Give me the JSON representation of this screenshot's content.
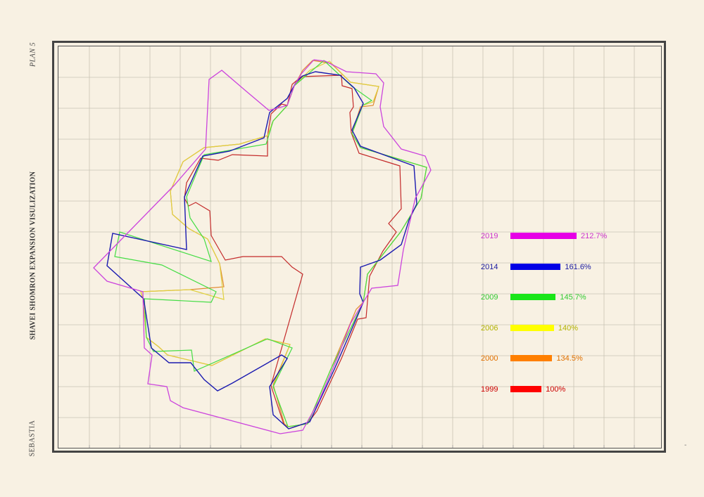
{
  "labels": {
    "plan": "PLAN 5",
    "title": "SHAVEI SHOMRON EXPANSION VISULIZATION",
    "place": "SEBASTIA"
  },
  "legend": [
    {
      "year": "2019",
      "percent_label": "212.7%",
      "percent": 212.7,
      "color": "#e600e6",
      "text_color": "#cc33cc"
    },
    {
      "year": "2014",
      "percent_label": "161.6%",
      "percent": 161.6,
      "color": "#0000e6",
      "text_color": "#1a1aa0"
    },
    {
      "year": "2009",
      "percent_label": "145.7%",
      "percent": 145.7,
      "color": "#19e619",
      "text_color": "#33cc33"
    },
    {
      "year": "2006",
      "percent_label": "140%",
      "percent": 140,
      "color": "#ffff00",
      "text_color": "#b3b300"
    },
    {
      "year": "2000",
      "percent_label": "134.5%",
      "percent": 134.5,
      "color": "#ff7f00",
      "text_color": "#e07000"
    },
    {
      "year": "1999",
      "percent_label": "100%",
      "percent": 100,
      "color": "#ff0000",
      "text_color": "#cc0000"
    }
  ],
  "outline_colors": {
    "2019": "#cc44dd",
    "2014": "#1a1ab0",
    "2009": "#44dd44",
    "2006": "#e0d040",
    "2000": "#e08a30",
    "1999": "#c42a2a"
  },
  "grid": true
}
